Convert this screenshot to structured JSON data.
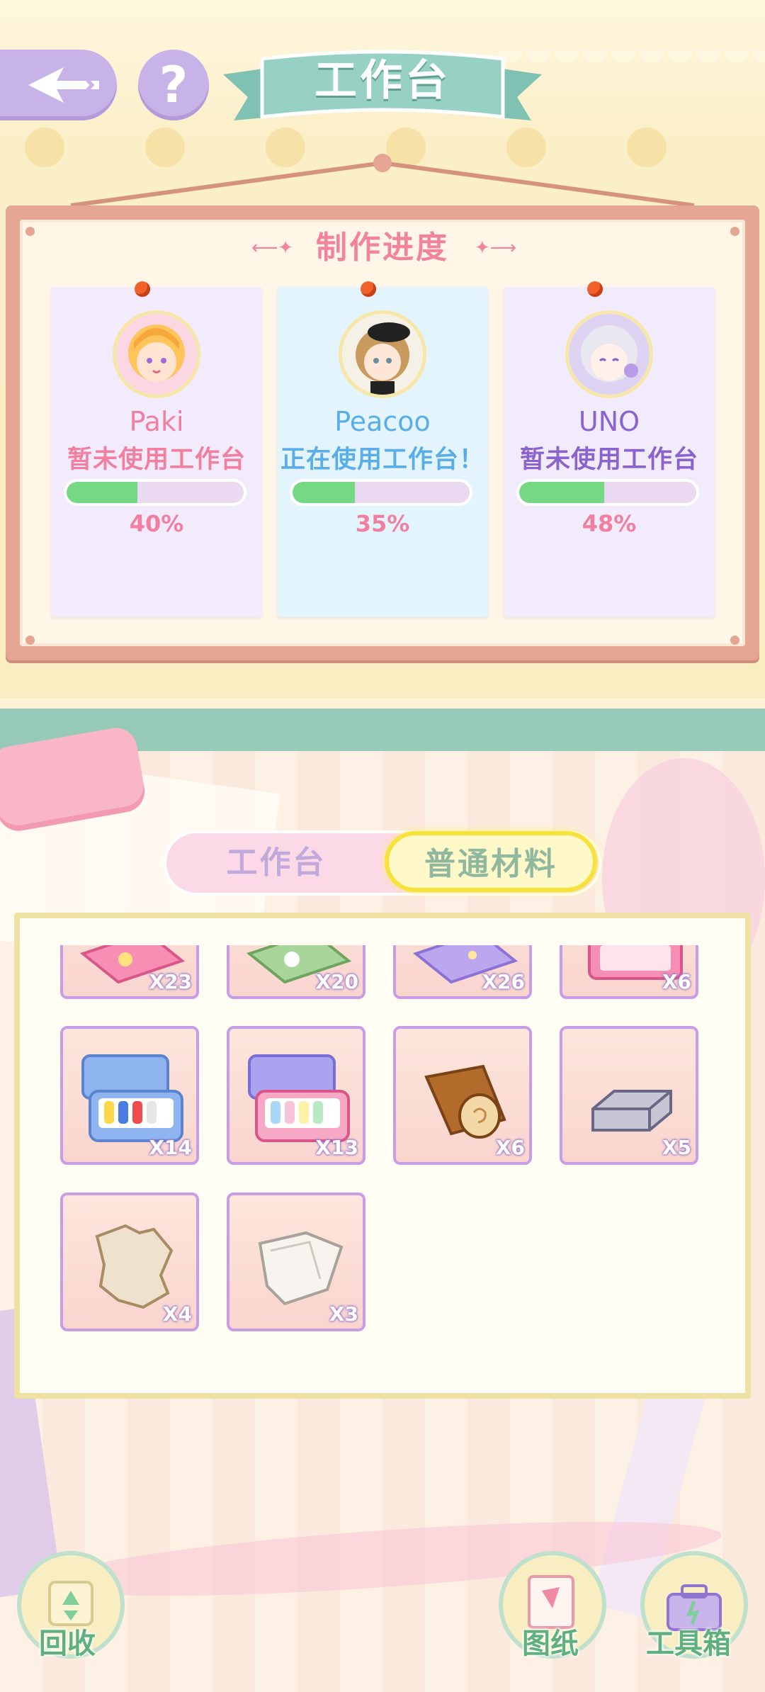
{
  "header": {
    "title": "工作台",
    "back_icon": "back-arrow-icon",
    "help_symbol": "?"
  },
  "board": {
    "title": "制作进度",
    "characters": [
      {
        "name": "Paki",
        "status": "暂未使用工作台",
        "progress": 0.4,
        "progress_text": "40%",
        "status_color": "#f07fa0",
        "name_color": "#f07fa0",
        "card_color": "#f1ebfb"
      },
      {
        "name": "Peacoo",
        "status": "正在使用工作台！",
        "progress": 0.35,
        "progress_text": "35%",
        "status_color": "#5aaee8",
        "name_color": "#5aaee8",
        "card_color": "#e4f4fd"
      },
      {
        "name": "UNO",
        "status": "暂未使用工作台",
        "progress": 0.48,
        "progress_text": "48%",
        "status_color": "#8a63cf",
        "name_color": "#8a63cf",
        "card_color": "#f1ebfb"
      }
    ]
  },
  "tabs": {
    "workbench": "工作台",
    "materials": "普通材料",
    "active": "materials"
  },
  "inventory": {
    "items": [
      {
        "icon": "pink-fabric-icon",
        "count": "X23"
      },
      {
        "icon": "green-flower-fabric-icon",
        "count": "X20"
      },
      {
        "icon": "purple-star-fabric-icon",
        "count": "X26"
      },
      {
        "icon": "pink-paint-box-icon",
        "count": "X6"
      },
      {
        "icon": "blue-paint-box-icon",
        "count": "X14"
      },
      {
        "icon": "purple-paint-box-icon",
        "count": "X13"
      },
      {
        "icon": "wood-log-icon",
        "count": "X6"
      },
      {
        "icon": "silver-ingot-icon",
        "count": "X5"
      },
      {
        "icon": "fur-pelt-icon",
        "count": "X4"
      },
      {
        "icon": "white-cloth-icon",
        "count": "X3"
      }
    ]
  },
  "bottom": {
    "recycle": "回收",
    "blueprint": "图纸",
    "toolbox": "工具箱"
  },
  "colors": {
    "accent_pink": "#f1849c",
    "teal": "#97cab9",
    "progress_green": "#74d885",
    "slot_border": "#c79ee6"
  }
}
